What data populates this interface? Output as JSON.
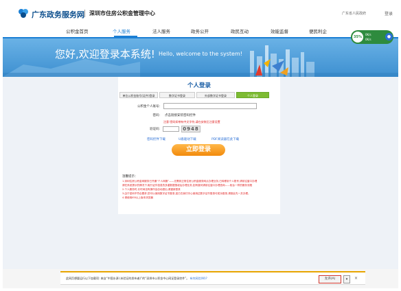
{
  "header": {
    "site_title": "广东政务服务网",
    "center_title": "深圳市住房公积金管理中心",
    "portal_link": "广东省人民政府",
    "login_link": "登录"
  },
  "nav": {
    "items": [
      "公积金首页",
      "个人服务",
      "法人服务",
      "政务公开",
      "政民互动",
      "效能监督",
      "便民利企"
    ],
    "active_index": 1
  },
  "speed_widget": {
    "percent": "35%",
    "up": "0K/s",
    "down": "0K/s"
  },
  "hero": {
    "title": "您好,欢迎登录本系统!",
    "subtitle": "Hello, welcome to the system!"
  },
  "login": {
    "title": "个人登录",
    "tabs": [
      "单位公积金账号(证件)登录",
      "数字证书登录",
      "外部数字证书登录",
      "个人登录"
    ],
    "active_tab": 3,
    "account_label": "公积金个人账号：",
    "password_label": "密码：",
    "password_hint": "点击链接安装密码控件",
    "red_tip": "注意:密码如带有中文字符,请在安装后注意设置",
    "captcha_label": "验证码：",
    "captcha_value": "0948",
    "download_links": [
      "密码控件下载",
      "U盾驱动下载",
      "PDF阅读器在此下载"
    ],
    "login_button": "立即登录",
    "notice_title": "温馨提示：",
    "notice_lines": [
      "1.深圳住房公积金网服务已开通“个人网服”——无需到正常住房公积金服务网点办理业务,已转移到个人账号,请前往窗口办理",
      "请在系统提示的情况下,取行证件信息的多重数据授权后办理业务,如有疑问请前往窗口办理查询——柜台一样的服务流程",
      "2.个人服务时,长时间没有操作会自动退出,请重新登录",
      "3.由于密码不符合要求,您可以使用数字证书登录,如已在我们中心使用过数字证书登录可成功登录,请按此先一并办理。",
      "4.请使用IE8以上版本浏览器"
    ]
  },
  "notification": {
    "text": "此网页想要运行以下加载项: 来自“中国水源 (未验证的发布者)”的“深圳市公积金中心网证登录控件”。",
    "link": "有何风险(W)?",
    "allow_button": "允许(A)",
    "dropdown": "▾",
    "close": "×"
  },
  "colors": {
    "brand_blue": "#1b7fd4",
    "hero_top": "#6ab2e6",
    "login_button": "#f28a0c",
    "active_tab": "#7dbb32",
    "warning_red": "#e02020"
  }
}
